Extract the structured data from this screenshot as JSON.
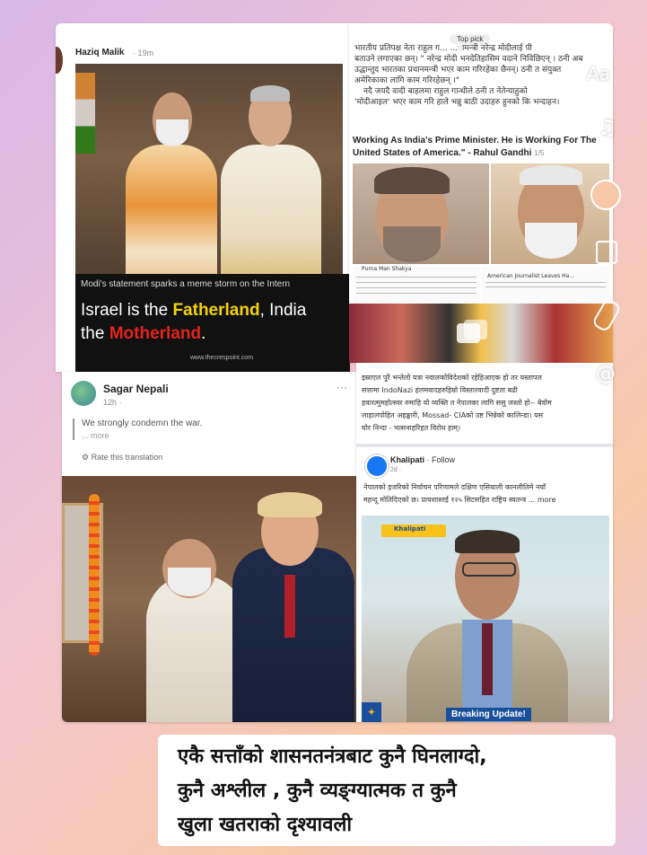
{
  "colors": {
    "accent_yellow": "#f5d20a",
    "accent_red": "#e2231a",
    "fb_blue": "#1877f2",
    "breaking_bg": "#1a4f9c"
  },
  "post1": {
    "author": "Haziq Malik",
    "time": "· 19m",
    "ticker": "Modi's statement sparks a meme storm on the Intern",
    "headline_pre": "Israel is the ",
    "headline_father": "Fatherland",
    "headline_mid": ", India",
    "headline_line2_pre": "the ",
    "headline_mother": "Motherland",
    "headline_end": ".",
    "site": "www.thecrespoint.com"
  },
  "post2": {
    "badge": "Top pick",
    "text_lines": [
      "भारतीय प्रतिपक्ष नेता राहुल ग...          ...ामन्त्री नरेन्द्र मोदीलाई पी",
      "बताउने लगाएका छन्। \" नरेन्द्र मोदी भनदेतिहासिम वदाने निविछिएन् । ठनी अब",
      "उद्धान्तुद भारतका प्रधानमन्त्री भएर काम गरिरहेका छैनन्। ठनी त संयुक्त",
      "अमेरिकाका लागि काम गरिरहेछन् ।\"",
      "नदै जयदै वादी बाहलमा राहुल गान्धीले ठनी त नेतेन्याहुको",
      "'मोदीआइल' भएर काम गरि हाले भन्नु बाठी उदाहरु हुनको कि भन्दाहन।"
    ],
    "quote_line1": "Working As India's Prime Minister. He is Working For The",
    "quote_line2": "United States of America.\" - Rahul Gandhi",
    "quote_page": "1/5",
    "mini_author_left": "Purna Man Shakya",
    "mini_author_right": "American Journalist Leaves Ha..."
  },
  "post3": {
    "author": "Sagar Nepali",
    "time": "12h ·",
    "more_dots": "···",
    "text": "We strongly condemn the war.",
    "more": "... more",
    "translate": "Rate this translation"
  },
  "post4": {
    "text_lines": [
      "इस्राएल पूरै भन्तेलो यत्रा नवालकोविदेशको रहेहिआएक हो  तर यस्तापल",
      "सत्तामा IndoNazi हंलमवादहरुहिम्रो विस्तारवादी दुष्टता बढी",
      "हवारत्मुमहोत्स्वर रुमाहि यो व्यक्ति त नेपालका लागि ससु जस्तो हो-- बेवोम",
      "लाहालपोहित अहङ्कारी, Mossad- CIAको उष्ट भिन्नेको कालिन्डा। यस",
      "घोर निन्दा - भत्सनाहरिहत विरोध हाम्।"
    ],
    "page": "Khalipati",
    "follow": "· Follow",
    "time": "2d ·",
    "desc_line1": "नेपालको इजरिको निर्वाचन परिणामले दक्षिण एसियाली कानलीतिमे नयाँ",
    "desc_line2": "महन्दू मोतिदिएको छ। प्रायशास्तई १२५ सिटसहित राष्ट्रिय स्वतन्त्र ... more",
    "logo_text": "Khalipati",
    "breaking": "Breaking Update!"
  },
  "caption": {
    "line1": "एकै सत्ताँको शासनतनंत्रबाट कुनै   घिनलाग्दो,",
    "line2": "कुनै अश्लील ,   कुनै व्यङ्ग्यात्मक त कुनै",
    "line3": "खुला खतराको   दृश्यावली"
  },
  "side_icons": [
    "text-icon",
    "music-icon",
    "color-icon",
    "sticker-icon",
    "draw-icon",
    "mention-icon"
  ],
  "side_labels": {
    "text": "Aa",
    "music": "♫",
    "mention": "@"
  }
}
